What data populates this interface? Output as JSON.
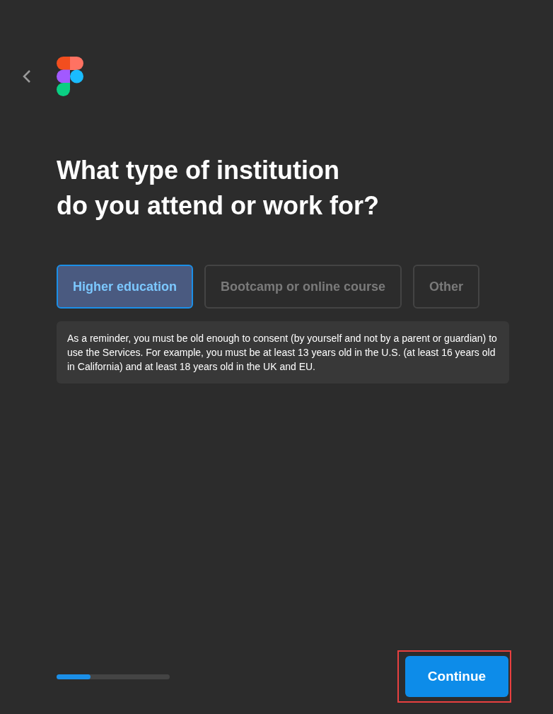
{
  "heading": [
    "What type of institution",
    "do you attend or work for?"
  ],
  "options": [
    {
      "label": "Higher education",
      "selected": true
    },
    {
      "label": "Bootcamp or online course",
      "selected": false
    },
    {
      "label": "Other",
      "selected": false
    }
  ],
  "note": "As a reminder, you must be old enough to consent (by yourself and not by a parent or guardian) to use the Services. For example, you must be at least 13 years old in the U.S. (at least 16 years old in California) and at least 18 years old in the UK and EU.",
  "progress": {
    "level": 0.3
  },
  "continue_button": {
    "label": "Continue",
    "highlighted": true
  }
}
